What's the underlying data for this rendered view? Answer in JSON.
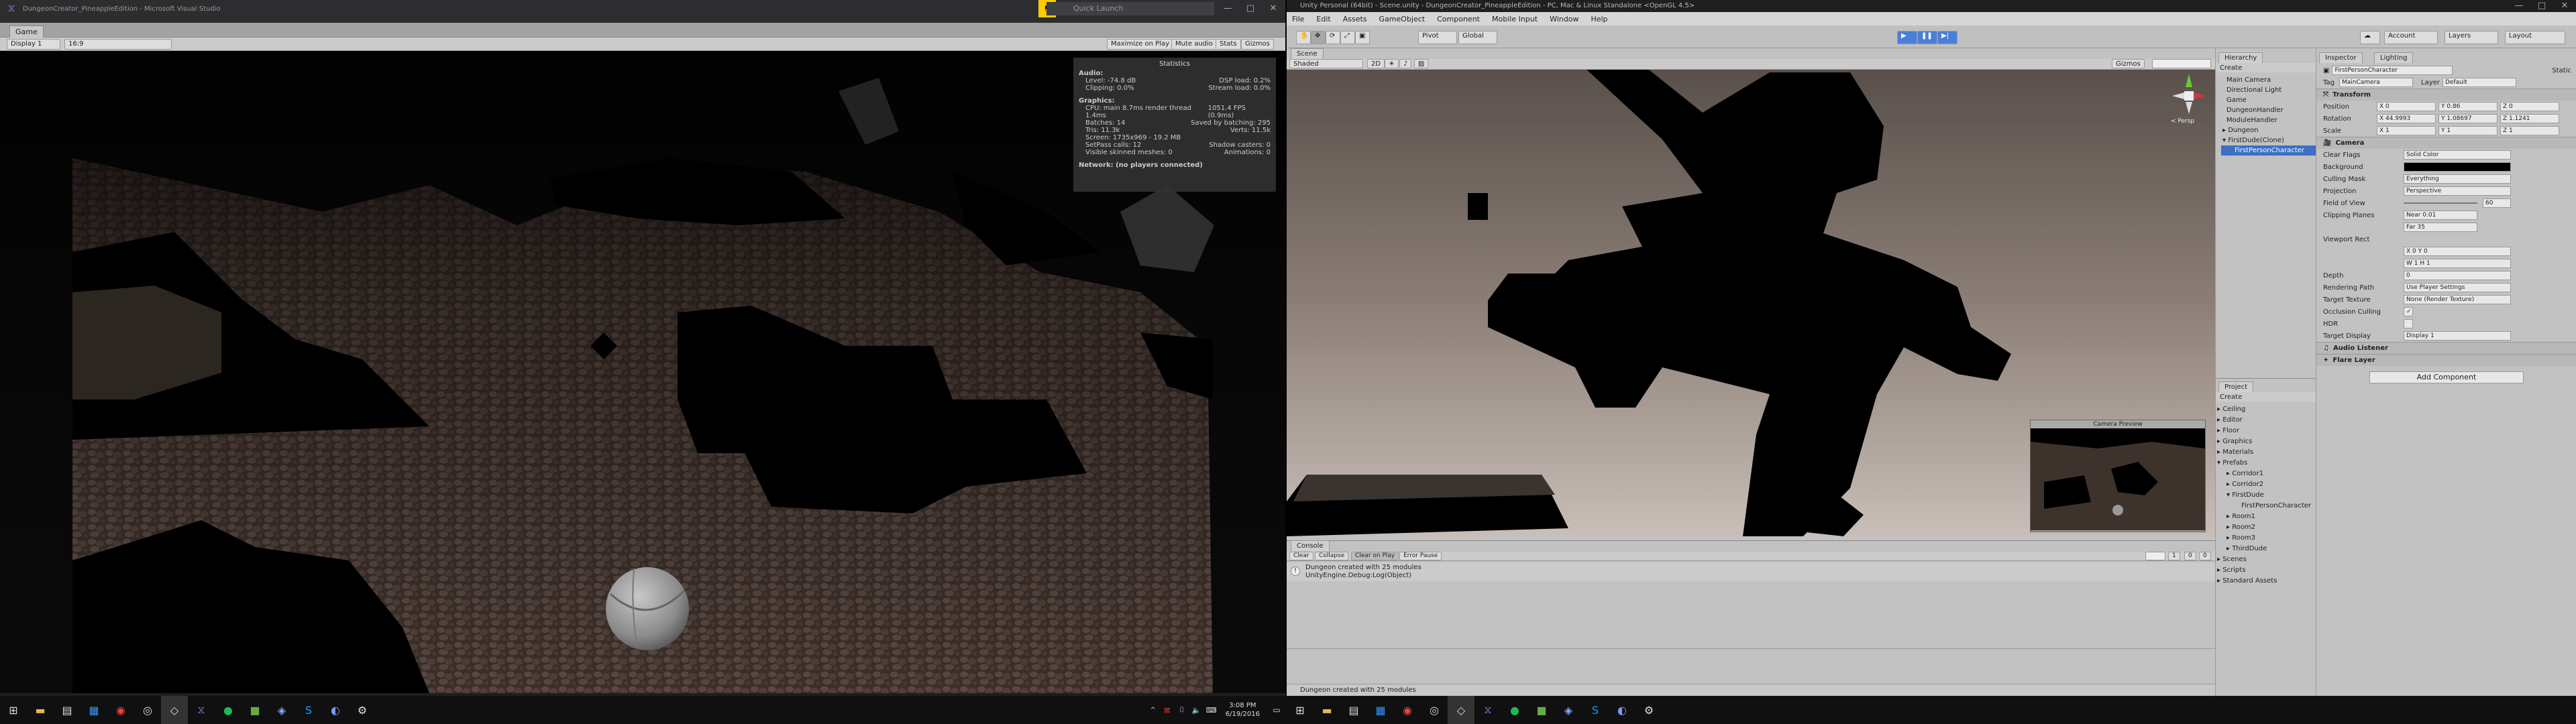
{
  "vs": {
    "title": "DungeonCreator_PineappleEdition - Microsoft Visual Studio",
    "quick_launch": "Quick Launch"
  },
  "game": {
    "tab": "Game",
    "display": "Display 1",
    "aspect": "16:9",
    "buttons": [
      "Maximize on Play",
      "Mute audio",
      "Stats",
      "Gizmos"
    ]
  },
  "stats": {
    "title": "Statistics",
    "audio_hd": "Audio:",
    "audio_rows": [
      [
        "Level: -74.8 dB",
        "DSP load: 0.2%"
      ],
      [
        "Clipping: 0.0%",
        "Stream load: 0.0%"
      ]
    ],
    "graphics_hd": "Graphics:",
    "graphics_rows": [
      [
        "CPU: main 8.7ms  render thread 1.4ms",
        "1051.4 FPS (0.9ms)"
      ],
      [
        "Batches: 14",
        "Saved by batching: 295"
      ],
      [
        "Tris: 11.3k",
        "Verts: 11.5k"
      ],
      [
        "Screen: 1735x969 - 19.2 MB",
        ""
      ],
      [
        "SetPass calls: 12",
        "Shadow casters: 0"
      ],
      [
        "Visible skinned meshes: 0",
        "Animations: 0"
      ]
    ],
    "network": "Network: (no players connected)"
  },
  "unity": {
    "title": "Unity Personal (64bit) - Scene.unity - DungeonCreator_PineappleEdition - PC, Mac & Linux Standalone <OpenGL 4.5>",
    "menu": [
      "File",
      "Edit",
      "Assets",
      "GameObject",
      "Component",
      "Mobile Input",
      "Window",
      "Help"
    ],
    "pivot": "Pivot",
    "global": "Global",
    "account": "Account",
    "layers": "Layers",
    "layout": "Layout",
    "scene_tab": "Scene",
    "shaded": "Shaded",
    "twod": "2D",
    "gizmos": "Gizmos",
    "persp": "< Persp",
    "camera_preview": "Camera Preview"
  },
  "hierarchy": {
    "tab": "Hierarchy",
    "create": "Create",
    "items": [
      "Main Camera",
      "Directional Light",
      "Game",
      "DungeonHandler",
      "ModuleHandler",
      "▸ Dungeon",
      "▾ FirstDude(Clone)",
      "FirstPersonCharacter"
    ]
  },
  "project": {
    "tab": "Project",
    "create": "Create",
    "items": [
      "▸ Ceiling",
      "▸ Editor",
      "▸ Floor",
      "▸ Graphics",
      "▸ Materials",
      "▾ Prefabs",
      "▸ Corridor1",
      "▸ Corridor2",
      "▾ FirstDude",
      "FirstPersonCharacter",
      "▸ Room1",
      "▸ Room2",
      "▸ Room3",
      "▸ ThirdDude",
      "▸ Scenes",
      "▸ Scripts",
      "▸ Standard Assets"
    ]
  },
  "inspector": {
    "tab": "Inspector",
    "tab2": "Lighting",
    "object_name": "FirstPersonCharacter",
    "static": "Static",
    "tag_label": "Tag",
    "tag": "MainCamera",
    "layer_label": "Layer",
    "layer": "Default",
    "transform": "Transform",
    "position_label": "Position",
    "position": [
      "X 0",
      "Y 0.86",
      "Z 0"
    ],
    "rotation_label": "Rotation",
    "rotation": [
      "X 44.9993",
      "Y 1.08697",
      "Z 1.1241"
    ],
    "scale_label": "Scale",
    "scale": [
      "X 1",
      "Y 1",
      "Z 1"
    ],
    "camera": "Camera",
    "camera_rows": [
      [
        "Clear Flags",
        "Solid Color"
      ],
      [
        "Background",
        ""
      ],
      [
        "Culling Mask",
        "Everything"
      ],
      [
        "Projection",
        "Perspective"
      ],
      [
        "Field of View",
        "60"
      ],
      [
        "Clipping Planes",
        "Near 0.01"
      ],
      [
        "",
        "Far 35"
      ],
      [
        "Viewport Rect",
        ""
      ],
      [
        "",
        "X 0   Y 0"
      ],
      [
        "",
        "W 1   H 1"
      ],
      [
        "Depth",
        "0"
      ],
      [
        "Rendering Path",
        "Use Player Settings"
      ],
      [
        "Target Texture",
        "None (Render Texture)"
      ],
      [
        "Occlusion Culling",
        "✓"
      ],
      [
        "HDR",
        ""
      ],
      [
        "Target Display",
        "Display 1"
      ]
    ],
    "audio_listener": "Audio Listener",
    "flare_layer": "Flare Layer",
    "add_component": "Add Component"
  },
  "console": {
    "tab": "Console",
    "buttons": [
      "Clear",
      "Collapse",
      "Clear on Play",
      "Error Pause"
    ],
    "msg1": "Dungeon created with 25 modules",
    "msg2": "UnityEngine.Debug:Log(Object)",
    "counts": [
      "1",
      "0",
      "0"
    ]
  },
  "status": "Dungeon created with 25 modules",
  "clock": {
    "time": "3:08 PM",
    "date": "6/19/2016"
  }
}
